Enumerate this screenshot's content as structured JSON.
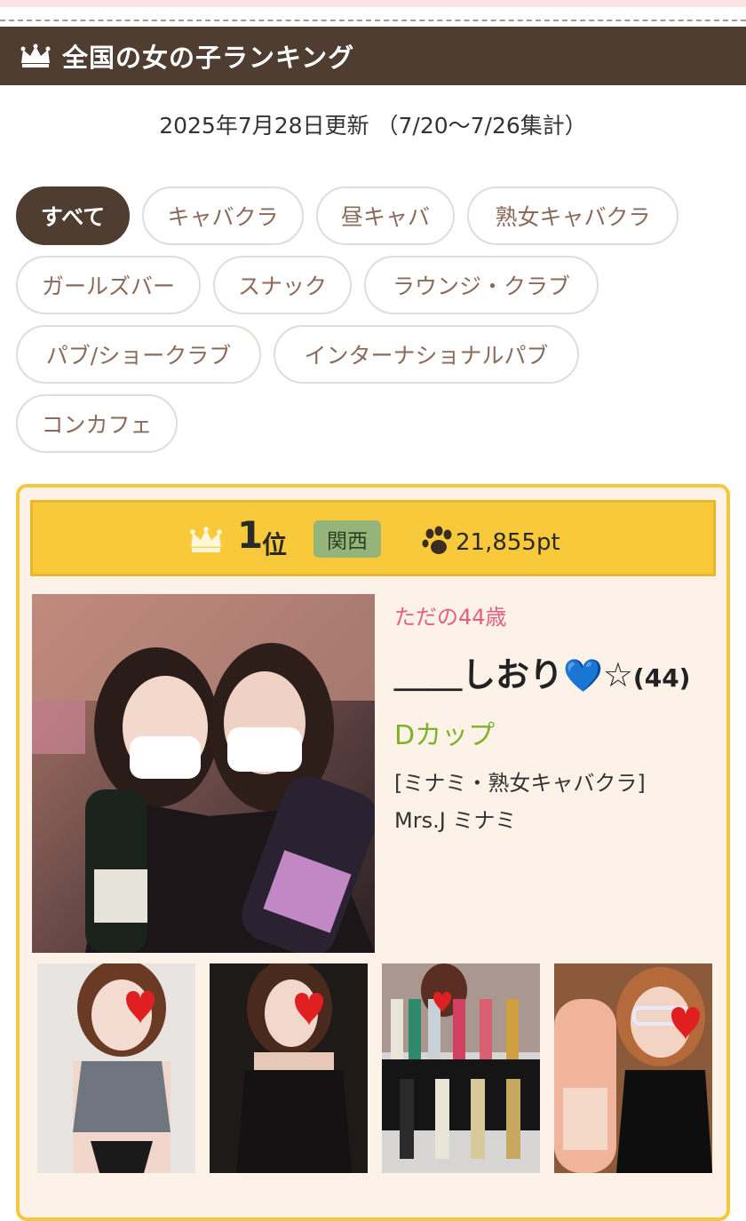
{
  "header": {
    "title": "全国の女の子ランキング",
    "icon": "crown-icon"
  },
  "updated": "2025年7月28日更新 （7/20〜7/26集計）",
  "filters": [
    {
      "label": "すべて",
      "active": true
    },
    {
      "label": "キャバクラ",
      "active": false
    },
    {
      "label": "昼キャバ",
      "active": false
    },
    {
      "label": "熟女キャバクラ",
      "active": false
    },
    {
      "label": "ガールズバー",
      "active": false
    },
    {
      "label": "スナック",
      "active": false
    },
    {
      "label": "ラウンジ・クラブ",
      "active": false
    },
    {
      "label": "パブ/ショークラブ",
      "active": false
    },
    {
      "label": "インターナショナルパブ",
      "active": false
    },
    {
      "label": "コンカフェ",
      "active": false
    }
  ],
  "ranking": [
    {
      "rank": "1",
      "rank_suffix": "位",
      "region": "関西",
      "points": "21,855pt",
      "catchphrase": "ただの44歳",
      "name": "＿＿しおり",
      "name_heart": "💙",
      "name_star": "☆",
      "age": "(44)",
      "cup": "Dカップ",
      "shop_category": "[ミナミ・熟女キャバクラ]",
      "shop_name": "Mrs.J ミナミ"
    }
  ],
  "colors": {
    "header_bg": "#4e3d30",
    "accent_gold": "#f8c93a",
    "card_bg": "#fdf2e8",
    "region_green": "#94b47a",
    "catch_pink": "#e2607a",
    "cup_green": "#7fb02a",
    "pill_text": "#8a6a5a"
  }
}
